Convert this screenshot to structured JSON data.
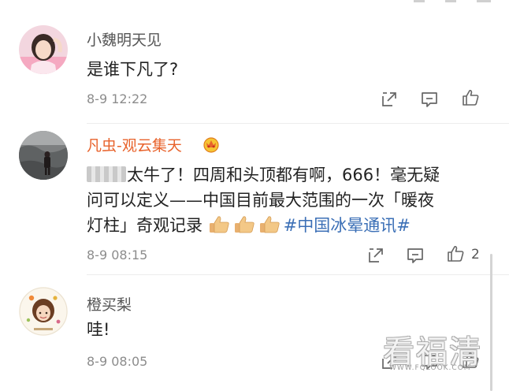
{
  "comments": [
    {
      "username": "小魏明天见",
      "text_lines": [
        "是谁下凡了?"
      ],
      "timestamp": "8-9 12:22",
      "like_count": ""
    },
    {
      "username": "凡虫-观云集天",
      "text_lines": [
        "太牛了！四周和头顶都有啊，666！毫无疑",
        "问可以定义——中国目前最大范围的一次「暖夜",
        "灯柱」奇观记录"
      ],
      "hashtag": "#中国冰晕通讯#",
      "timestamp": "8-9 08:15",
      "like_count": "2"
    },
    {
      "username": "橙买梨",
      "text_lines": [
        "哇!"
      ],
      "timestamp": "8-9 08:05",
      "like_count": ""
    }
  ],
  "watermark": {
    "main": "看福清",
    "url": "WWW.FQLOOK.COM"
  },
  "icons": {
    "share": "share-icon",
    "comment": "comment-icon",
    "like": "thumbs-up-icon",
    "badge": "crown-badge-icon",
    "thumb_emoji": "thumbs-up-emoji"
  },
  "colors": {
    "vip_username": "#e8632c",
    "hashtag": "#3b6fb6",
    "meta_text": "#8c8c8c"
  }
}
